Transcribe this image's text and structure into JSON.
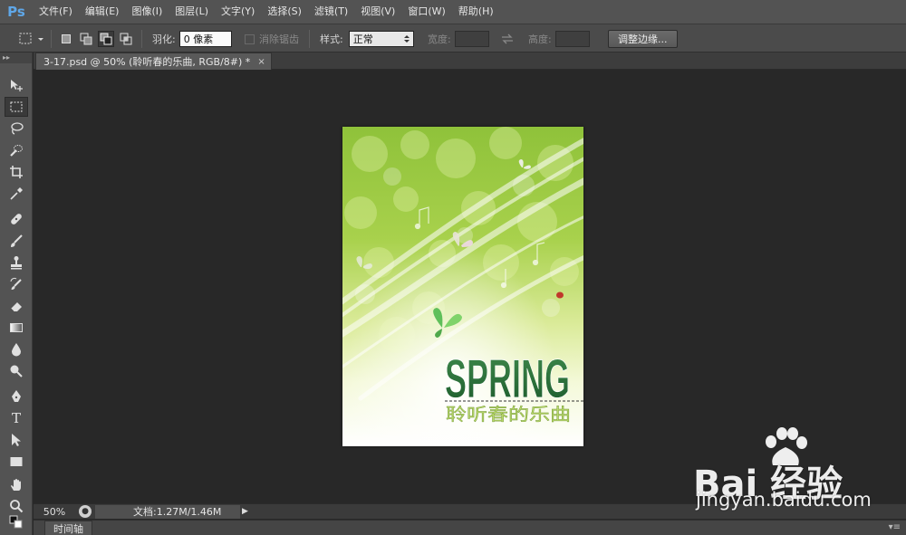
{
  "app": {
    "logo": "Ps"
  },
  "menu": {
    "items": [
      "文件(F)",
      "编辑(E)",
      "图像(I)",
      "图层(L)",
      "文字(Y)",
      "选择(S)",
      "滤镜(T)",
      "视图(V)",
      "窗口(W)",
      "帮助(H)"
    ]
  },
  "options": {
    "feather_label": "羽化:",
    "feather_value": "0 像素",
    "antialias_label": "消除锯齿",
    "style_label": "样式:",
    "style_value": "正常",
    "width_label": "宽度:",
    "height_label": "高度:",
    "refine_edge_label": "调整边缘..."
  },
  "document": {
    "tab_title": "3-17.psd @ 50% (聆听春的乐曲, RGB/8#) *",
    "tab_close": "×",
    "artwork_title": "SPRING",
    "artwork_subtitle": "聆听春的乐曲"
  },
  "status": {
    "zoom": "50%",
    "doc_info": "文档:1.27M/1.46M"
  },
  "panels": {
    "timeline_tab": "时间轴"
  },
  "watermark": {
    "brand": "Bai 经验",
    "url": "jingyan.baidu.com"
  },
  "colors": {
    "menubar": "#535353",
    "canvas_bg": "#282828",
    "title_green": "#2e6b3f"
  }
}
